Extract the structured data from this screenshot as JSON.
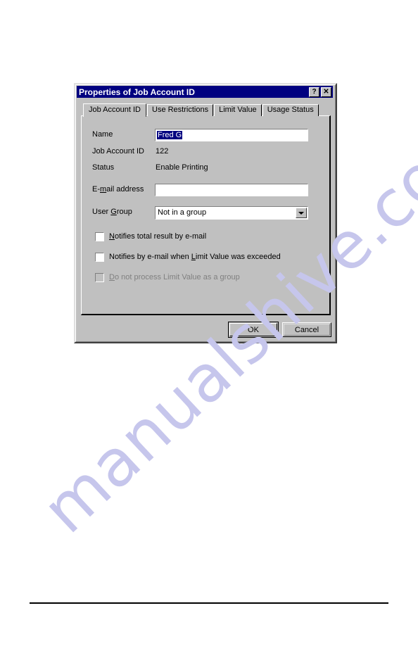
{
  "window": {
    "title": "Properties of Job Account ID",
    "help_button": "?",
    "close_button": "✕"
  },
  "tabs": [
    {
      "label": "Job Account ID",
      "active": true
    },
    {
      "label": "Use Restrictions",
      "active": false
    },
    {
      "label": "Limit Value",
      "active": false
    },
    {
      "label": "Usage Status",
      "active": false
    }
  ],
  "form": {
    "name": {
      "label": "Name",
      "value": "Fred G",
      "selected": true
    },
    "job_account_id": {
      "label": "Job Account ID",
      "value": "122"
    },
    "status": {
      "label": "Status",
      "value": "Enable Printing"
    },
    "email_address": {
      "label_pre": "E-",
      "label_mnemonic": "m",
      "label_post": "ail address",
      "value": "",
      "placeholder": ""
    },
    "user_group": {
      "label_pre": "User ",
      "label_mnemonic": "G",
      "label_post": "roup",
      "value": "Not in a group",
      "options": [
        "Not in a group"
      ]
    }
  },
  "checkboxes": [
    {
      "name": "notifies-total-result-by-email",
      "label_pre": "",
      "label_mnemonic": "N",
      "label_post": "otifies total result by e-mail",
      "checked": false,
      "disabled": false
    },
    {
      "name": "notifies-by-email-when-limit-value-exceeded",
      "label_pre": "Notifies by e-mail when ",
      "label_mnemonic": "L",
      "label_post": "imit Value was exceeded",
      "checked": false,
      "disabled": false
    },
    {
      "name": "do-not-process-limit-value-as-group",
      "label_pre": "",
      "label_mnemonic": "D",
      "label_post": "o not process Limit Value as a group",
      "checked": false,
      "disabled": true
    }
  ],
  "buttons": {
    "ok": "OK",
    "cancel": "Cancel"
  },
  "watermark": {
    "text": "manualshive.com"
  },
  "colors": {
    "titlebar": "#000080",
    "dialog_face": "#c0c0c0",
    "selection": "#000080",
    "watermark": "#c6c6ec",
    "disabled_text": "#808080"
  }
}
